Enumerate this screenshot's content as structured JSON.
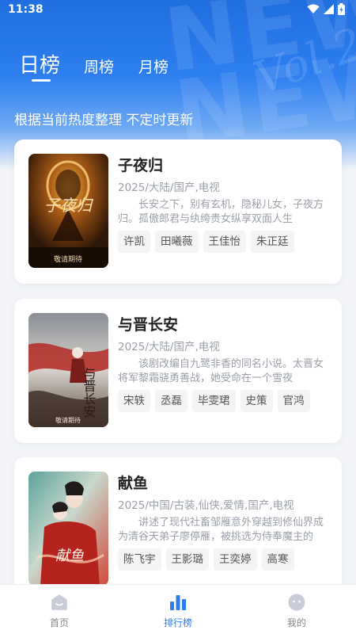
{
  "status_bar": {
    "time": "11:38"
  },
  "tabs": [
    {
      "label": "日榜",
      "active": true
    },
    {
      "label": "周榜",
      "active": false
    },
    {
      "label": "月榜",
      "active": false
    }
  ],
  "subtitle": "根据当前热度整理 不定时更新",
  "items": [
    {
      "title": "子夜归",
      "meta": "2025/大陆/国产,电视",
      "desc": "长安之下，别有玄机，隐秘儿女，子夜方归。孤傲郎君与纨绔贵女纵享双面人生",
      "tags": [
        "许凯",
        "田曦薇",
        "王佳怡",
        "朱正廷"
      ],
      "poster": {
        "title": "子夜归",
        "caption": "敬请期待"
      }
    },
    {
      "title": "与晋长安",
      "meta": "2025/大陆/国产,电视",
      "desc": "该剧改编自九鹭非香的同名小说。太晋女将军黎霜骁勇善战，她受命在一个雪夜",
      "tags": [
        "宋轶",
        "丞磊",
        "毕雯珺",
        "史策",
        "官鸿"
      ],
      "poster": {
        "title": "与晋长安",
        "caption": "敬请期待"
      }
    },
    {
      "title": "献鱼",
      "meta": "2025/中国/古装,仙侠,爱情,国产,电视",
      "desc": "讲述了现代社畜邹雁意外穿越到修仙界成为清谷天弟子廖停雁，被挑选为侍奉魔主的",
      "tags": [
        "陈飞宇",
        "王影璐",
        "王奕婷",
        "高寒"
      ],
      "poster": {
        "title": "献鱼"
      }
    }
  ],
  "bottom_nav": [
    {
      "label": "首页",
      "icon": "home-icon",
      "active": false
    },
    {
      "label": "排行榜",
      "icon": "ranking-icon",
      "active": true
    },
    {
      "label": "我的",
      "icon": "profile-icon",
      "active": false
    }
  ],
  "colors": {
    "accent": "#2a7cf0",
    "header": "#1f6fe0",
    "background": "#f2f4f8"
  }
}
